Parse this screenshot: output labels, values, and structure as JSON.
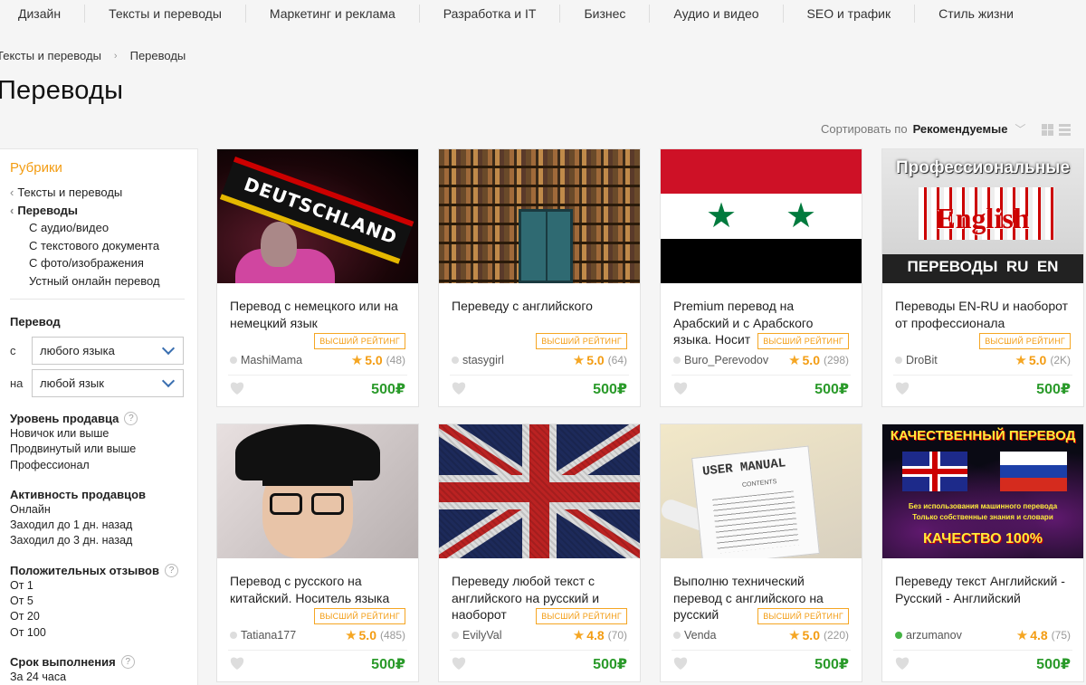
{
  "topnav": [
    "Дизайн",
    "Тексты и переводы",
    "Маркетинг и реклама",
    "Разработка и IT",
    "Бизнес",
    "Аудио и видео",
    "SEO и трафик",
    "Стиль жизни"
  ],
  "breadcrumb": {
    "parent": "Тексты и переводы",
    "current": "Переводы"
  },
  "page_title": "Переводы",
  "sort": {
    "label": "Сортировать по",
    "value": "Рекомендуемые"
  },
  "sidebar": {
    "rubriki": "Рубрики",
    "parent_cat": "Тексты и переводы",
    "active_cat": "Переводы",
    "subcats": [
      "С аудио/видео",
      "С текстового документа",
      "С фото/изображения",
      "Устный онлайн перевод"
    ],
    "translation": {
      "title": "Перевод",
      "from_label": "с",
      "from_value": "любого языка",
      "to_label": "на",
      "to_value": "любой язык"
    },
    "filters": [
      {
        "title": "Уровень продавца",
        "help": true,
        "options": [
          "Новичок или выше",
          "Продвинутый или выше",
          "Профессионал"
        ]
      },
      {
        "title": "Активность продавцов",
        "help": false,
        "options": [
          "Онлайн",
          "Заходил до 1 дн. назад",
          "Заходил до 3 дн. назад"
        ]
      },
      {
        "title": "Положительных отзывов",
        "help": true,
        "options": [
          "От 1",
          "От 5",
          "От 20",
          "От 100"
        ]
      },
      {
        "title": "Срок выполнения",
        "help": true,
        "options": [
          "За 24 часа"
        ]
      }
    ]
  },
  "cards": [
    {
      "title": "Перевод с немецкого или на немецкий язык",
      "badge": "ВЫСШИЙ РЕЙТИНГ",
      "seller": "MashiMama",
      "online": false,
      "rating": "5.0",
      "reviews": "(48)",
      "price": "500₽",
      "thumb_text": "DEUTSCHLAND"
    },
    {
      "title": "Переведу с английского",
      "badge": "ВЫСШИЙ РЕЙТИНГ",
      "seller": "stasygirl",
      "online": false,
      "rating": "5.0",
      "reviews": "(64)",
      "price": "500₽"
    },
    {
      "title": "Premium перевод на Арабский и с Арабского языка. Носит",
      "badge": "ВЫСШИЙ РЕЙТИНГ",
      "seller": "Buro_Perevodov",
      "online": false,
      "rating": "5.0",
      "reviews": "(298)",
      "price": "500₽"
    },
    {
      "title": "Переводы EN-RU и наоборот от профессионала",
      "badge": "ВЫСШИЙ РЕЙТИНГ",
      "seller": "DroBit",
      "online": false,
      "rating": "5.0",
      "reviews": "(2K)",
      "price": "500₽",
      "thumb_lines": [
        "Профессиональные",
        "English",
        "ПЕРЕВОДЫ  RU  EN"
      ]
    },
    {
      "title": "Перевод с русского на китайский. Носитель языка",
      "badge": "ВЫСШИЙ РЕЙТИНГ",
      "seller": "Tatiana177",
      "online": false,
      "rating": "5.0",
      "reviews": "(485)",
      "price": "500₽"
    },
    {
      "title": "Переведу любой текст с английского на русский и наоборот",
      "badge": "ВЫСШИЙ РЕЙТИНГ",
      "seller": "EvilyVal",
      "online": false,
      "rating": "4.8",
      "reviews": "(70)",
      "price": "500₽"
    },
    {
      "title": "Выполню технический перевод с английского на русский",
      "badge": "ВЫСШИЙ РЕЙТИНГ",
      "seller": "Venda",
      "online": false,
      "rating": "5.0",
      "reviews": "(220)",
      "price": "500₽",
      "thumb_lines": [
        "USER MANUAL",
        "CONTENTS"
      ]
    },
    {
      "title": "Переведу текст Английский - Русский - Английский",
      "badge": "",
      "seller": "arzumanov",
      "online": true,
      "rating": "4.8",
      "reviews": "(75)",
      "price": "500₽",
      "thumb_lines": [
        "КАЧЕСТВЕННЫЙ ПЕРЕВОД",
        "Без использования машинного перевода",
        "Только собственные знания и словари",
        "КАЧЕСТВО 100%"
      ]
    }
  ],
  "colors": {
    "accent": "#f39c12",
    "price": "#2a9a2a",
    "online": "#44b344"
  }
}
